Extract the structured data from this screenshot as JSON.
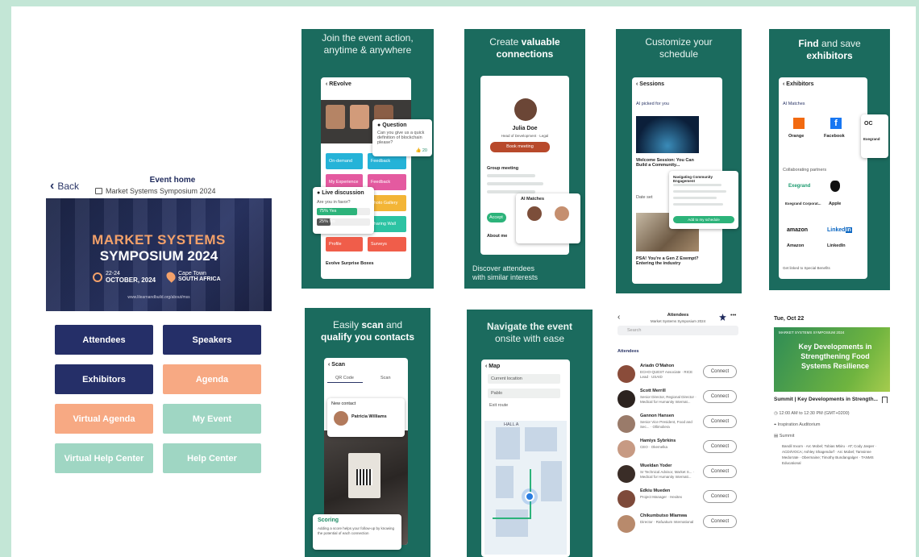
{
  "event_home": {
    "back_label": "Back",
    "title": "Event home",
    "subtitle": "Market Systems Symposium 2024",
    "banner": {
      "line1": "MARKET SYSTEMS",
      "line2": "SYMPOSIUM 2024",
      "date_prefix": "22-24",
      "date": "OCTOBER, 2024",
      "city": "Cape Town",
      "country": "SOUTH AFRICA",
      "url": "www.lilearnandbuild.org/about/mss"
    },
    "buttons": [
      {
        "label": "Attendees"
      },
      {
        "label": "Speakers"
      },
      {
        "label": "Exhibitors"
      },
      {
        "label": "Agenda"
      },
      {
        "label": "Virtual Agenda"
      },
      {
        "label": "My Event"
      },
      {
        "label": "Virtual Help Center"
      },
      {
        "label": "Help Center"
      }
    ]
  },
  "panel_join": {
    "heading_l1": "Join the event action,",
    "heading_l2": "anytime & anywhere",
    "screen_title": "REvolve",
    "question_title": "Question",
    "question_text": "Can you give us a quick definition of blockchain please?",
    "question_votes": "20",
    "live_title": "Live discussion",
    "live_question": "Are you in favor?",
    "opt1": "75% Yes",
    "opt2": "25% No",
    "tiles": [
      "On-demand",
      "Feedback",
      "My Experience",
      "Feedback",
      "Documents",
      "Photo Gallery",
      "Sharing Wall",
      "Profile",
      "Surveys"
    ],
    "footer": "Evolve Surprise Boxes"
  },
  "panel_connect": {
    "heading_l1": "Create",
    "heading_bold1": "valuable",
    "heading_bold2": "connections",
    "name": "Julia Doe",
    "role": "Head of Development · Legal",
    "book_btn": "Book meeting",
    "group_meeting": "Group meeting",
    "accept": "Accept",
    "ai_title": "AI Matches",
    "about": "About me",
    "footer_l1": "Discover attendees",
    "footer_l2": "with similar interests"
  },
  "panel_schedule": {
    "heading_l1": "Customize your",
    "heading_l2": "schedule",
    "screen_title": "Sessions",
    "ai_picked": "AI picked for you",
    "learn_more": "Learn more",
    "session1": "Welcome Session: You Can Build a Community...",
    "popup_title": "Navigating Community Engagement",
    "popup_btn": "Add to my schedule",
    "date_label": "Date set",
    "session2": "PSA! You're a Gen Z Exempt? Entering the industry"
  },
  "panel_exhibitors": {
    "heading_l1": "Find",
    "heading_mid": "and save",
    "heading_bold": "exhibitors",
    "screen_title": "Exhibitors",
    "ai_matches": "AI Matches",
    "learn_more": "Learn more",
    "ex1": "Orange",
    "ex2": "Facebook",
    "ex3": "Exegrand",
    "partners_label": "Collaborating partners",
    "p1": "Exegrand",
    "p1_sub": "Exegrand Corporat...",
    "p2": "Apple",
    "p3": "Amazon",
    "p4": "LinkedIn",
    "footer": "Get linked to Special Benefits"
  },
  "panel_scan": {
    "heading_l1": "Easily",
    "heading_bold1": "scan",
    "heading_mid": "and",
    "heading_bold2": "qualify you contacts",
    "screen_title": "Scan",
    "tab1": "QR Code",
    "tab2": "Scan",
    "contact_label": "New contact",
    "contact_name": "Patricia Williams",
    "scoring": "Scoring",
    "scoring_text": "Adding a score helps your follow-up by knowing the potential of each connection"
  },
  "panel_map": {
    "heading_l1": "Navigate the event",
    "heading_l2": "onsite with ease",
    "screen_title": "Map",
    "search": "Current location",
    "filter": "Pablo",
    "exit": "Exit route",
    "zone": "HALL A"
  },
  "attendees": {
    "title": "Attendees",
    "subtitle": "Market Systems Symposium 2024",
    "search": "Search",
    "section": "Attendees",
    "connect_label": "Connect",
    "people": [
      {
        "name": "Ariadn O'Mahon",
        "role": "ECHO-QUEST Associate · RICE Lead · USAID"
      },
      {
        "name": "Scott Merrill",
        "role": "Senior Director, Regional Director · Medical for Humanity Internat..."
      },
      {
        "name": "Gannon Hansen",
        "role": "Senior Vice President, Food and Sec... · Ollimoliera"
      },
      {
        "name": "Hamiys Sybrkins",
        "role": "CEO · Okemelka"
      },
      {
        "name": "Wueldan Yoder",
        "role": "Sr Technical Advisor, Market S... · Medical for Humanity Internati..."
      },
      {
        "name": "Edkiu Mueden",
        "role": "Project Manager · Hexitex"
      },
      {
        "name": "Chikumbutso Mlamwa",
        "role": "Director · Rafuakum International"
      }
    ]
  },
  "agenda_item": {
    "date": "Tue, Oct 22",
    "banner_tag": "MARKET SYSTEMS SYMPOSIUM 2024",
    "banner_title": "Key Developments in Strengthening Food Systems Resilience",
    "title": "Summit | Key Developments in Strength...",
    "time": "12:00 AM to 12:30 PM",
    "tz": "(GMT+0200)",
    "location": "Inspiration Auditorium",
    "track": "Summit",
    "speakers": "Bandil Inxom · Arc Mobel; Tobias Mbiru · AT; Cody Jasper · ACDI/VOCA; Ashley Shagendorf · Arc Mobel; Tamsinne Medorrate · Obermaine; Timothy Bundangalger · TANMS Educational"
  },
  "colors": {
    "panel": "#1b6b5e",
    "navy": "#252f68",
    "peach": "#f7a983",
    "mint": "#9fd6c3",
    "accent_green": "#2cb37a",
    "frame": "#c3e6d6"
  }
}
